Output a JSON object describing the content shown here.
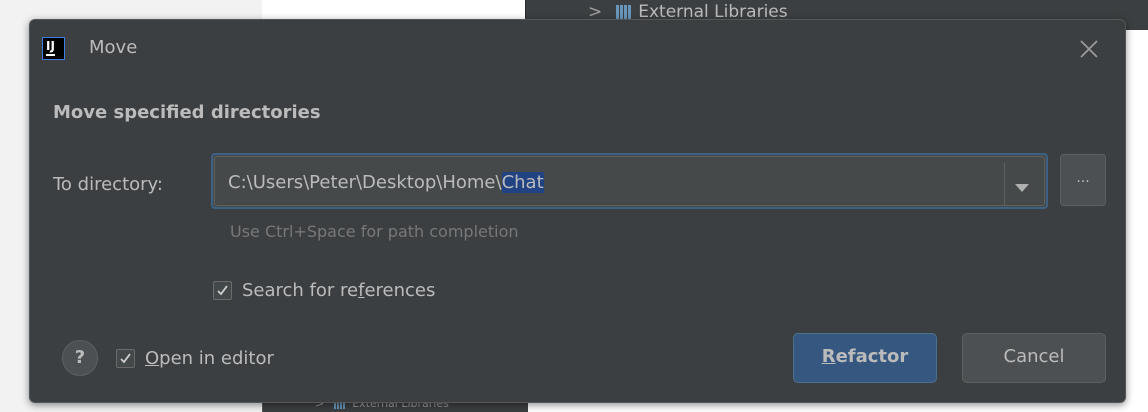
{
  "background": {
    "tree_item_top": "External Libraries",
    "tree_item_bottom": "External Libraries"
  },
  "dialog": {
    "title": "Move",
    "app_icon_text": "IJ",
    "heading": "Move specified directories",
    "directory_label": "To directory:",
    "directory_value_prefix": "C:\\Users\\Peter\\Desktop\\Home\\",
    "directory_value_selected": "Chat",
    "browse_label": "...",
    "hint": "Use Ctrl+Space for path completion",
    "search_refs": {
      "pre": "Search for re",
      "mnemonic": "f",
      "post": "erences",
      "checked": true
    },
    "open_in_editor": {
      "pre": "",
      "mnemonic": "O",
      "post": "pen in editor",
      "checked": true
    },
    "help_label": "?",
    "refactor": {
      "mnemonic": "R",
      "post": "efactor"
    },
    "cancel_label": "Cancel"
  },
  "colors": {
    "dialog_bg": "#3c3f41",
    "text": "#bbbbbb",
    "accent": "#365880",
    "selection": "#214283",
    "focus_border": "#3d6185"
  }
}
